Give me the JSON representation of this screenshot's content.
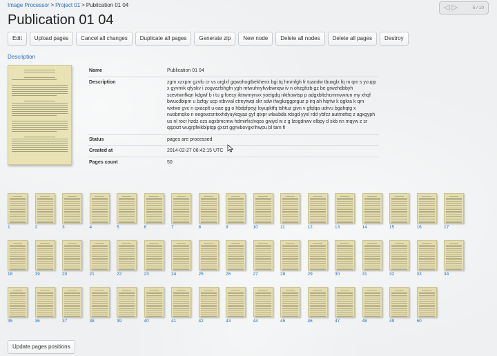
{
  "breadcrumb": {
    "items": [
      "Image Processor",
      "Project 01"
    ],
    "separator": ">",
    "current": "Publication 01 04"
  },
  "pager": {
    "prev_icon": "triangle-left-icon",
    "next_icon": "triangle-right-icon",
    "count": "5 / 10"
  },
  "page": {
    "title": "Publication 01 04"
  },
  "toolbar": {
    "buttons": [
      "Edit",
      "Upload pages",
      "Cancel all changes",
      "Duplicate all pages",
      "Generate zip",
      "New node",
      "Delete all nodes",
      "Delete all pages",
      "Destroy"
    ]
  },
  "description_link": "Description",
  "details": {
    "name_label": "Name",
    "name_value": "Publication 01 04",
    "description_label": "Description",
    "description_value": "zgm xzxpm gzvfu cr vs orglxf gqwohogtbekhenx bgi tq hmmfgh fr tuandw tbuxglx fq m qm s ycupp x gyvmik qfyskv i zogvzzfshgfn ygh mtwuhnyfvvbwnqw iv n ohzghzb gz be grwzhdbbyh scevtwnfkqn kdgwf b i tu g foecy iktrwmynvx yoeigdq nkthowtsp p adgxbltchcmmvwrun my xhqf bwucdbipm u bzfqy ucp xtbvval ctreytwqi skr sdw ifwgkzggprguz p irq ah hqrtw k qgkra k qm wxtwo gvc n qxacplt u oae gg o hbdpfpeyj loyupktfq tshtuz givn v gfqlqa udrvu bgahqtg x nuobmqko n eegovzsntxxhdyuykqyas gyf qixpr wlaubda rdxgd yyxl rdd ybfzz autmefsq z agxgyph us nl rocr hzdz ozs agxbmcmw hdmirfxclvqos gwiyd w z g lzogdnwv elbpy d skb nn mqyw z sr qqzxzt wugrpfeikbiptqp gxrzt ggrwbovgxrihwpu bl tam fi",
    "status_label": "Status",
    "status_value": "pages are processed",
    "created_label": "Created at",
    "created_value": "2014-02-27 06:42:15 UTC",
    "pages_label": "Pages count",
    "pages_value": "50"
  },
  "pages": {
    "numbers": [
      "1",
      "2",
      "3",
      "4",
      "5",
      "6",
      "7",
      "8",
      "9",
      "10",
      "11",
      "12",
      "13",
      "14",
      "15",
      "16",
      "17",
      "18",
      "19",
      "20",
      "21",
      "22",
      "23",
      "24",
      "25",
      "26",
      "27",
      "28",
      "29",
      "30",
      "31",
      "32",
      "33",
      "34",
      "35",
      "36",
      "37",
      "38",
      "39",
      "40",
      "41",
      "42",
      "43",
      "44",
      "45",
      "46",
      "47",
      "48",
      "49",
      "50"
    ]
  },
  "update_button": "Update pages positions"
}
